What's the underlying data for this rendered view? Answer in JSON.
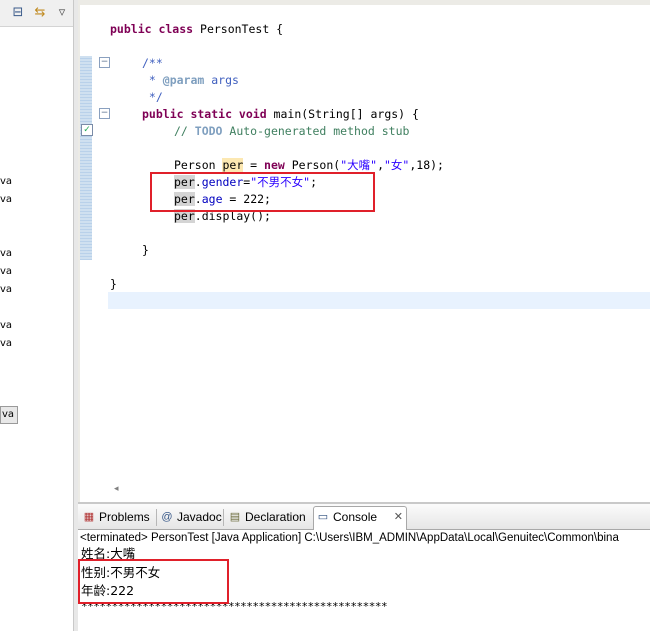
{
  "package_explorer": {
    "toolbar_icons": [
      "collapse-all-icon",
      "link-with-editor-icon",
      "view-menu-icon"
    ],
    "tree_items": [
      "va",
      "va",
      "va",
      "va",
      "va",
      "va",
      "va"
    ],
    "selected_item": "va"
  },
  "editor": {
    "lines": {
      "class_kw": "public class",
      "class_name": " PersonTest {",
      "jd_open": "/**",
      "jd_star": " * ",
      "jd_param": "@param",
      "jd_args": " args",
      "jd_close": " */",
      "main_kw": "public static void",
      "main_rest": " main(String[] args) {",
      "todo_prefix": "// ",
      "todo_tag": "TODO",
      "todo_rest": " Auto-generated method stub",
      "new_type": "Person ",
      "new_var": "per",
      "new_eq": " = ",
      "new_kw": "new",
      "new_ctor": " Person(",
      "new_s1": "\"大嘴\"",
      "new_comma": ",",
      "new_s2": "\"女\"",
      "new_end": ",18);",
      "g_obj": "per",
      "g_dot": ".",
      "g_field": "gender",
      "g_eq": "=",
      "g_str": "\"不男不女\"",
      "g_end": ";",
      "a_obj": "per",
      "a_dot": ".",
      "a_field": "age",
      "a_rest": " = 222;",
      "d_obj": "per",
      "d_rest": ".display();",
      "close_method": "}",
      "close_class": "}"
    }
  },
  "bottom_tabs": {
    "problems": "Problems",
    "javadoc": "Javadoc",
    "declaration": "Declaration",
    "console": "Console",
    "console_close": "✕"
  },
  "console": {
    "header": "<terminated> PersonTest [Java Application] C:\\Users\\IBM_ADMIN\\AppData\\Local\\Genuitec\\Common\\bina",
    "output": [
      "姓名:大嘴",
      "性别:不男不女",
      "年龄:222",
      "**************************************************"
    ]
  },
  "colors": {
    "highlight_box": "#e0202a",
    "keyword": "#7f0055",
    "comment": "#3f7f5f",
    "string": "#2a00ff",
    "field": "#0000c0"
  }
}
